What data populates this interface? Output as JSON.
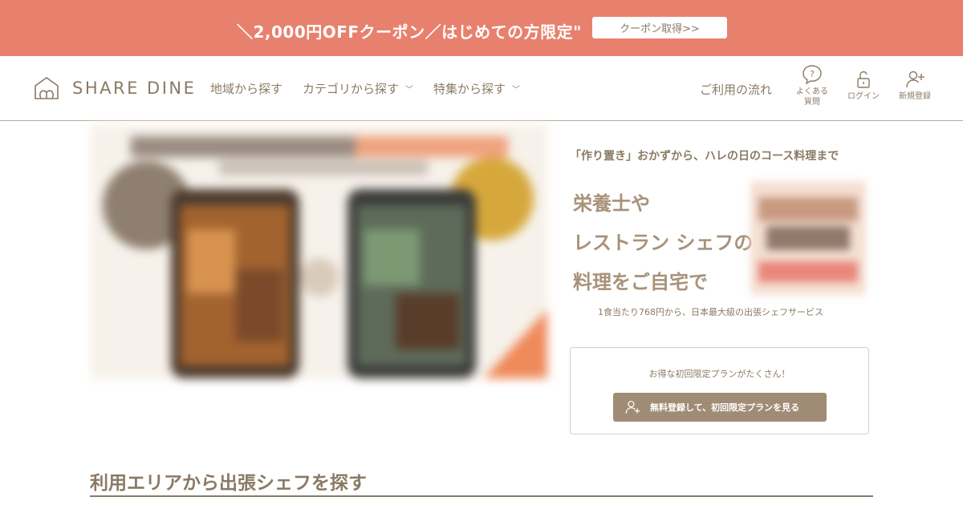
{
  "banner": {
    "text": "＼2,000円OFFクーポン／はじめての方限定\"",
    "button_label": "クーポン取得>>"
  },
  "header": {
    "logo_text": "SHARE DINE",
    "nav": [
      {
        "label": "地域から探す",
        "has_dropdown": false
      },
      {
        "label": "カテゴリから探す",
        "has_dropdown": true
      },
      {
        "label": "特集から探す",
        "has_dropdown": true
      }
    ],
    "flow_link": "ご利用の流れ",
    "faq_label_1": "よくある",
    "faq_label_2": "質問",
    "login_label": "ログイン",
    "signup_label": "新規登録"
  },
  "hero": {
    "tagline": "「作り置き」おかずから、ハレの日のコース料理まで",
    "headline_1": "栄養士や",
    "headline_2": "レストラン シェフの",
    "headline_3": "料理をご自宅で",
    "subline": "1食当たり768円から、日本最大級の出張シェフサービス"
  },
  "card": {
    "note": "お得な初回限定プランがたくさん！",
    "button_label": "無料登録して、初回限定プランを見る"
  },
  "section": {
    "title": "利用エリアから出張シェフを探す"
  },
  "colors": {
    "banner": "#e8806e",
    "brand": "#8a7a65",
    "button": "#a08c74"
  }
}
